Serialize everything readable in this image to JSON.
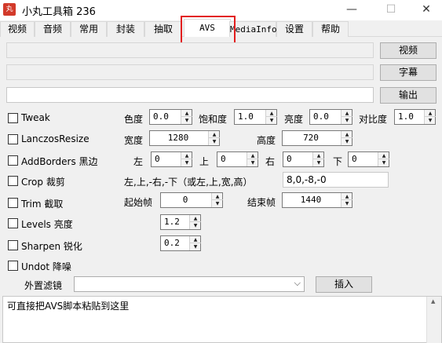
{
  "window": {
    "title": "小丸工具箱 236",
    "icon_text": "丸",
    "minimize": "—",
    "maximize": "☐",
    "close": "✕"
  },
  "tabs": [
    "视频",
    "音频",
    "常用",
    "封装",
    "抽取",
    "AVS",
    "MediaInfo",
    "设置",
    "帮助"
  ],
  "active_tab": "AVS",
  "inputs": {
    "video_button": "视频",
    "subtitle_button": "字幕",
    "output_button": "输出"
  },
  "tweak": {
    "label": "Tweak",
    "hue_label": "色度",
    "hue": "0.0",
    "saturation_label": "饱和度",
    "saturation": "1.0",
    "brightness_label": "亮度",
    "brightness": "0.0",
    "contrast_label": "对比度",
    "contrast": "1.0"
  },
  "resize": {
    "label": "LanczosResize",
    "width_label": "宽度",
    "width": "1280",
    "height_label": "高度",
    "height": "720"
  },
  "addborders": {
    "label": "AddBorders 黑边",
    "left_label": "左",
    "left": "0",
    "top_label": "上",
    "top": "0",
    "right_label": "右",
    "right": "0",
    "bottom_label": "下",
    "bottom": "0"
  },
  "crop": {
    "label": "Crop 裁剪",
    "hint": "左,上,-右,-下（或左,上,宽,高）",
    "value": "8,0,-8,-0"
  },
  "trim": {
    "label": "Trim 截取",
    "start_label": "起始帧",
    "start": "0",
    "end_label": "结束帧",
    "end": "1440"
  },
  "levels": {
    "label": "Levels 亮度",
    "value": "1.2"
  },
  "sharpen": {
    "label": "Sharpen 锐化",
    "value": "0.2"
  },
  "undot": {
    "label": "Undot 降噪"
  },
  "external_filter": {
    "label": "外置滤镜",
    "value": "",
    "insert_button": "插入"
  },
  "script_area": {
    "text": "可直接把AVS脚本粘贴到这里"
  }
}
